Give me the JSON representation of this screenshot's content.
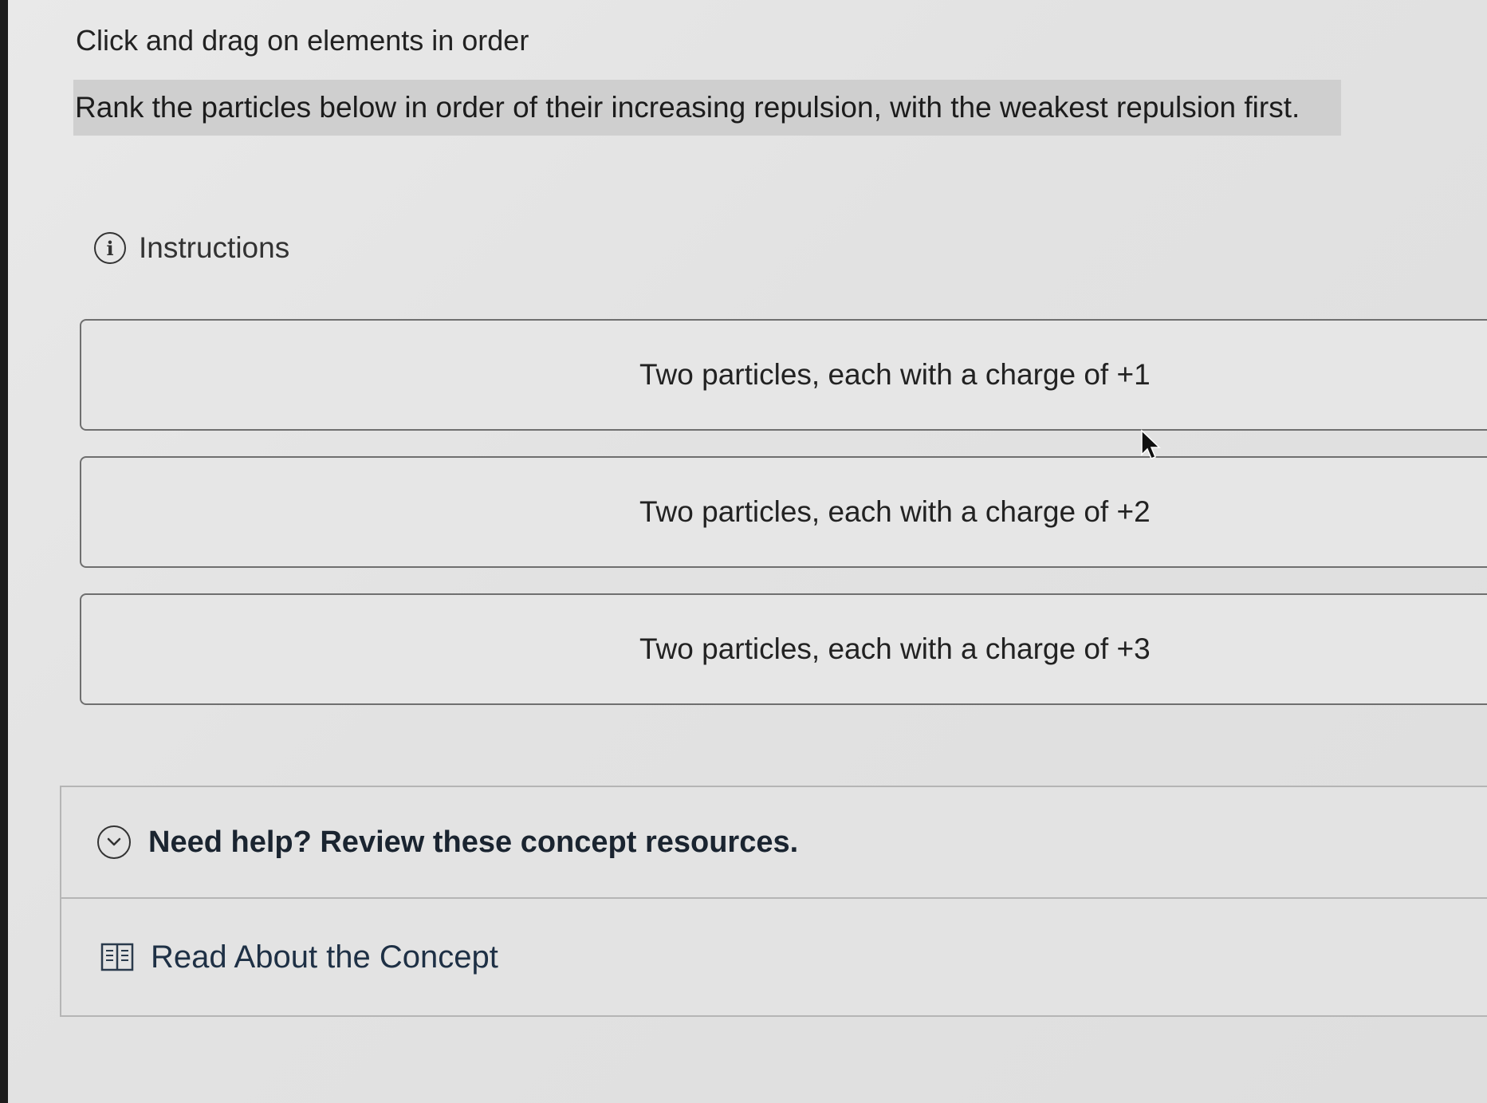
{
  "header": {
    "title": "Click and drag on elements in order"
  },
  "prompt": {
    "text": "Rank the particles below in order of their increasing repulsion, with the weakest repulsion first."
  },
  "instructions": {
    "label": "Instructions",
    "icon": "info-icon"
  },
  "rank_items": [
    {
      "label": "Two particles, each with a charge of +1"
    },
    {
      "label": "Two particles, each with a charge of +2"
    },
    {
      "label": "Two particles, each with a charge of +3"
    }
  ],
  "help": {
    "title": "Need help? Review these concept resources.",
    "icon": "chevron-down-icon",
    "resources": [
      {
        "label": "Read About the Concept",
        "icon": "book-icon"
      }
    ]
  },
  "colors": {
    "banner_bg": "#cfcfcf",
    "help_title": "#1a2430",
    "resource_link": "#1e3045"
  }
}
